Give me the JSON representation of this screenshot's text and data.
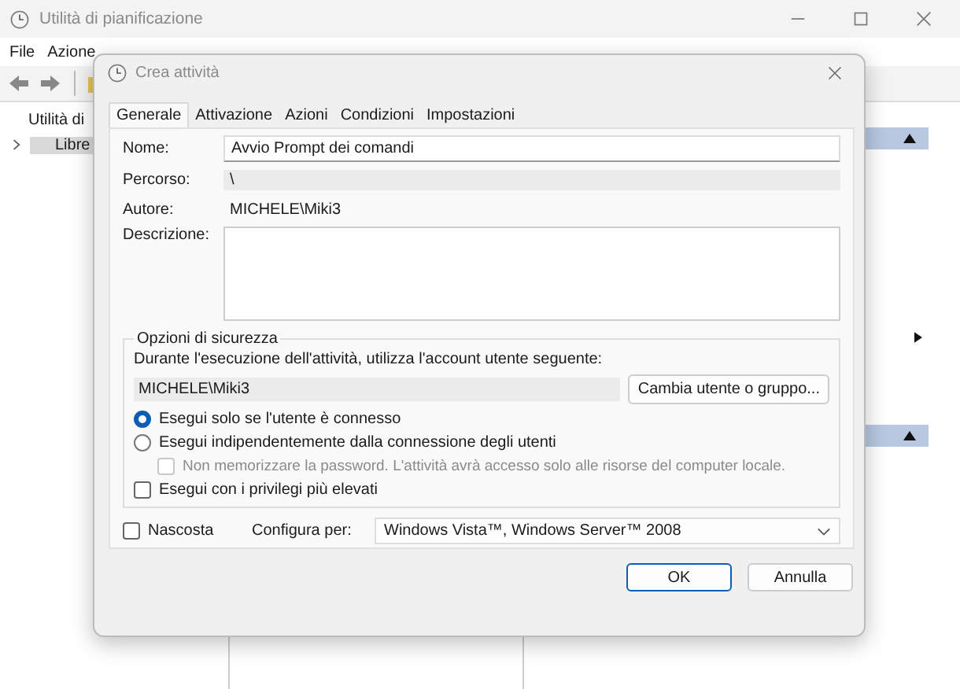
{
  "main_window": {
    "title": "Utilità di pianificazione",
    "menu": [
      "File",
      "Azione"
    ],
    "tree": [
      {
        "label": "Utilità di",
        "selected": false,
        "children": [
          {
            "label": "Libre",
            "selected": true,
            "expanded": false
          }
        ]
      }
    ]
  },
  "dialog": {
    "title": "Crea attività",
    "tabs": [
      {
        "label": "Generale",
        "selected": true
      },
      {
        "label": "Attivazione",
        "selected": false
      },
      {
        "label": "Azioni",
        "selected": false
      },
      {
        "label": "Condizioni",
        "selected": false
      },
      {
        "label": "Impostazioni",
        "selected": false
      }
    ],
    "name": {
      "label": "Nome:",
      "value": "Avvio Prompt dei comandi"
    },
    "path": {
      "label": "Percorso:",
      "value": "\\"
    },
    "author": {
      "label": "Autore:",
      "value": "MICHELE\\Miki3"
    },
    "description": {
      "label": "Descrizione:"
    },
    "security": {
      "legend": "Opzioni di sicurezza",
      "account_prompt": "Durante l'esecuzione dell'attività, utilizza l'account utente seguente:",
      "account": "MICHELE\\Miki3",
      "change_button": "Cambia utente o gruppo...",
      "radios": [
        {
          "label": "Esegui solo se l'utente è connesso",
          "selected": true
        },
        {
          "label": "Esegui indipendentemente dalla connessione degli utenti",
          "selected": false
        }
      ],
      "no_password": {
        "label": "Non memorizzare la password. L'attività avrà accesso solo alle risorse del computer locale.",
        "checked": false,
        "disabled": true
      },
      "highest": {
        "label": "Esegui con i privilegi più elevati",
        "checked": false,
        "disabled": false
      }
    },
    "hidden": {
      "label": "Nascosta",
      "checked": false,
      "disabled": false
    },
    "configure": {
      "label": "Configura per:",
      "value": "Windows Vista™, Windows Server™ 2008"
    },
    "buttons": [
      {
        "label": "OK",
        "default": true
      },
      {
        "label": "Annulla",
        "default": false
      }
    ]
  }
}
